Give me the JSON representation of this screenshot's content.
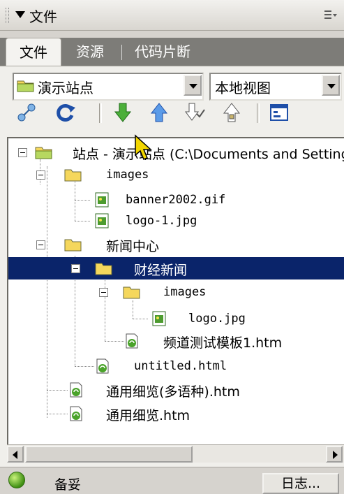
{
  "panel": {
    "title": "文件"
  },
  "tabs": [
    {
      "label": "文件"
    },
    {
      "label": "资源"
    },
    {
      "label": "代码片断"
    }
  ],
  "site_select": {
    "value": "演示站点"
  },
  "view_select": {
    "value": "本地视图"
  },
  "toolbar": {
    "buttons": [
      "connect-icon",
      "refresh-icon",
      "get-file-icon",
      "put-file-icon",
      "check-out-icon",
      "check-in-icon",
      "expand-panel-icon"
    ]
  },
  "tree": {
    "items": [
      {
        "label": "站点 - 演示站点 (C:\\Documents and Settings"
      },
      {
        "label": "images"
      },
      {
        "label": "banner2002.gif"
      },
      {
        "label": "logo-1.jpg"
      },
      {
        "label": "新闻中心"
      },
      {
        "label": "财经新闻"
      },
      {
        "label": "images"
      },
      {
        "label": "logo.jpg"
      },
      {
        "label": "频道测试模板1.htm"
      },
      {
        "label": "untitled.html"
      },
      {
        "label": "通用细览(多语种).htm"
      },
      {
        "label": "通用细览.htm"
      }
    ],
    "selected_index": 5
  },
  "status": {
    "text": "备妥",
    "log_button": "日志..."
  },
  "colors": {
    "selection": "#0a246a",
    "folder": "#f5d75c",
    "panel": "#d6d3ce"
  }
}
